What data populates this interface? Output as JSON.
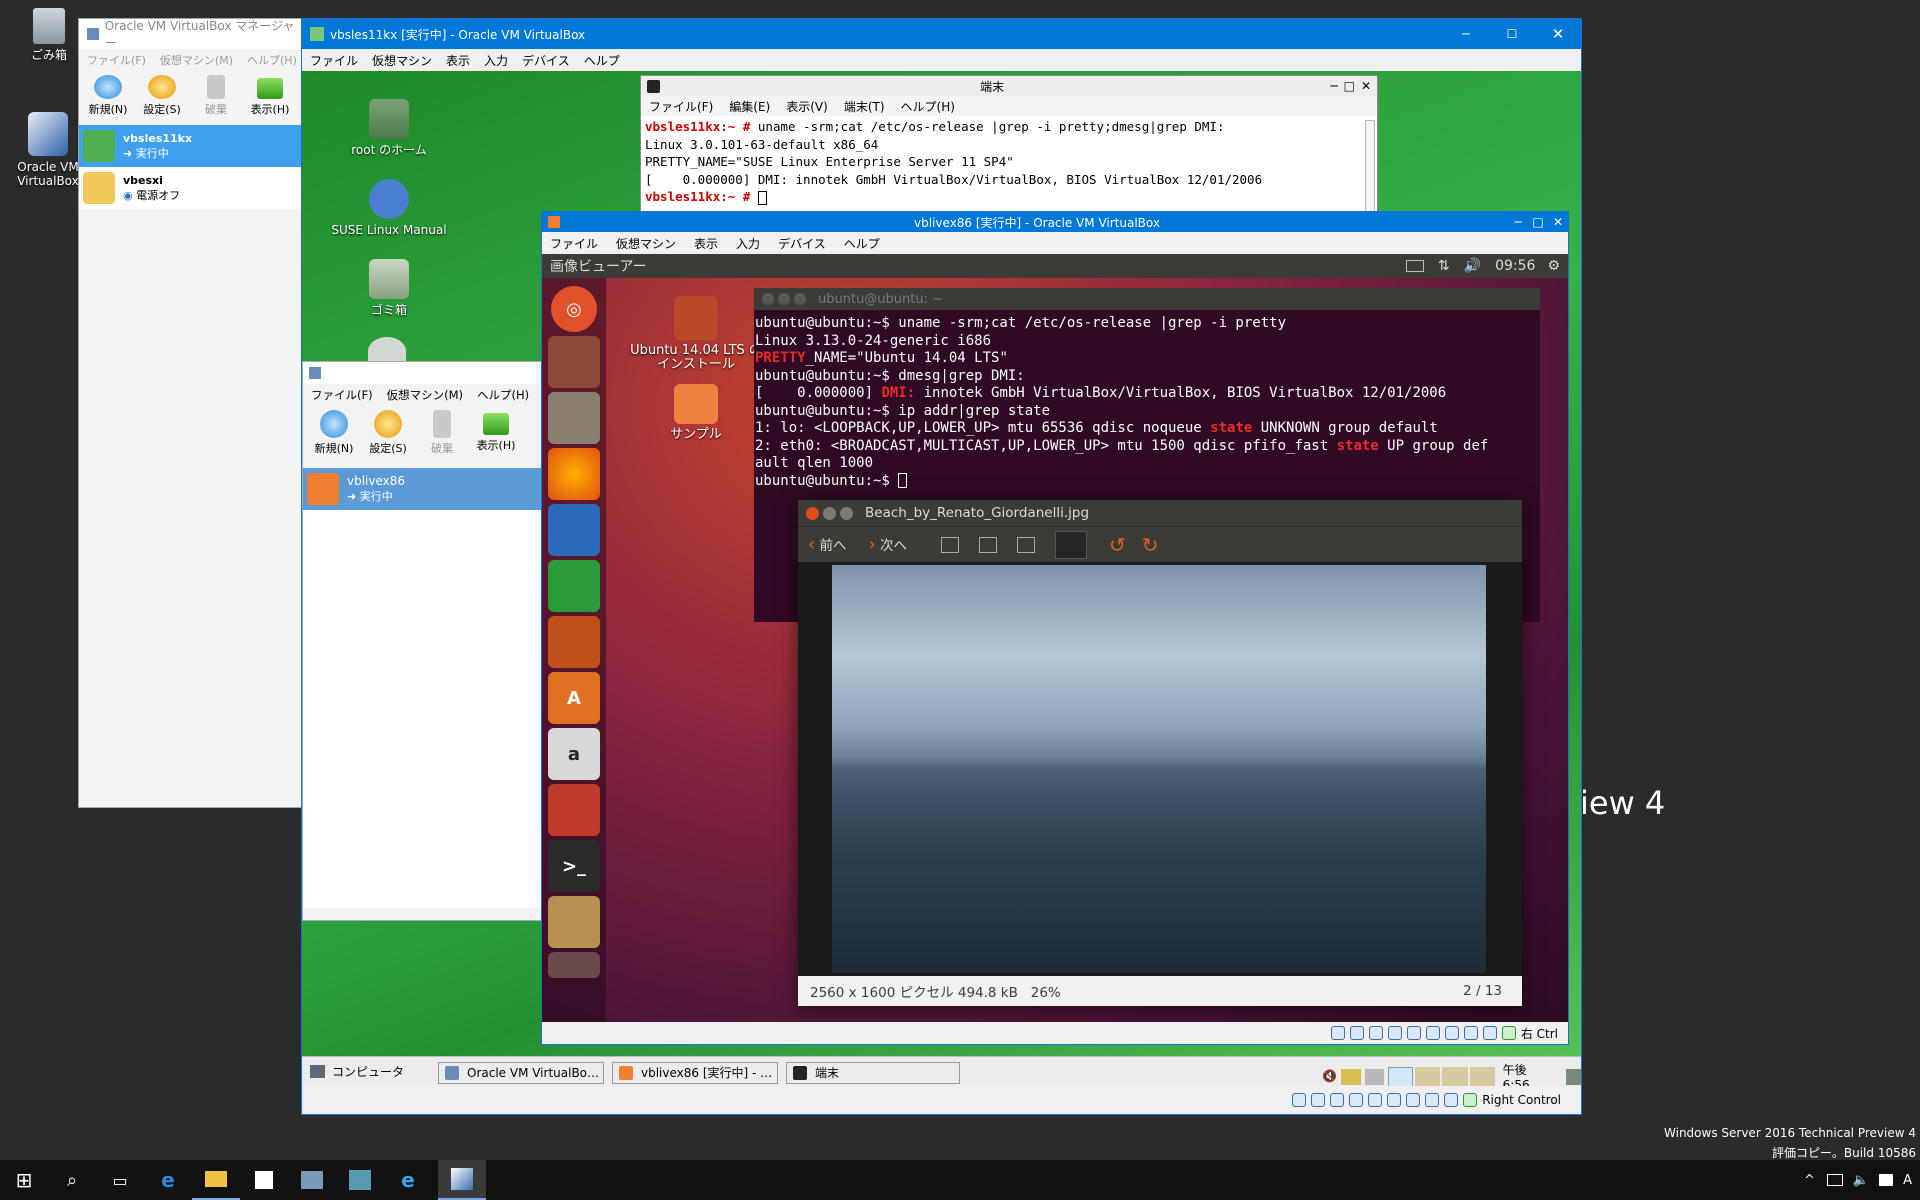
{
  "desktop": {
    "icons": [
      {
        "label": "ごみ箱"
      },
      {
        "label": "Oracle VM VirtualBox"
      }
    ],
    "watermark_fragment": "iew 4",
    "winver_line1": "Windows Server 2016 Technical Preview 4",
    "winver_line2": "評価コピー。Build 10586"
  },
  "vbox_manager_host": {
    "title": "Oracle VM VirtualBox マネージャー",
    "menu": [
      "ファイル(F)",
      "仮想マシン(M)",
      "ヘルプ(H)"
    ],
    "toolbar": [
      "新規(N)",
      "設定(S)",
      "破棄",
      "表示(H)"
    ],
    "vms": [
      {
        "name": "vbsles11kx",
        "state": "実行中"
      },
      {
        "name": "vbesxi",
        "state": "電源オフ"
      }
    ]
  },
  "suse_vm_window": {
    "title": "vbsles11kx [実行中] - Oracle VM VirtualBox",
    "menu": [
      "ファイル",
      "仮想マシン",
      "表示",
      "入力",
      "デバイス",
      "ヘルプ"
    ],
    "desktop_icons": [
      "root のホーム",
      "SUSE Linux Manual",
      "ゴミ箱"
    ],
    "taskbar": {
      "start": "コンピュータ",
      "items": [
        "Oracle VM VirtualBo…",
        "vblivex86 [実行中] - …",
        "端末"
      ],
      "clock": "午後 6:56"
    },
    "status_right": "Right Control"
  },
  "suse_terminal": {
    "title": "端末",
    "menu": [
      "ファイル(F)",
      "編集(E)",
      "表示(V)",
      "端末(T)",
      "ヘルプ(H)"
    ],
    "lines": [
      {
        "prompt": "vbsles11kx:~ # ",
        "text": "uname -srm;cat /etc/os-release |grep -i pretty;dmesg|grep DMI:"
      },
      {
        "prompt": "",
        "text": "Linux 3.0.101-63-default x86_64"
      },
      {
        "prompt": "",
        "text": "PRETTY_NAME=\"SUSE Linux Enterprise Server 11 SP4\""
      },
      {
        "prompt": "",
        "text": "[    0.000000] DMI: innotek GmbH VirtualBox/VirtualBox, BIOS VirtualBox 12/01/2006"
      },
      {
        "prompt": "vbsles11kx:~ # ",
        "text": ""
      }
    ]
  },
  "suse_vbox_manager": {
    "menu": [
      "ファイル(F)",
      "仮想マシン(M)",
      "ヘルプ(H)"
    ],
    "toolbar": [
      "新規(N)",
      "設定(S)",
      "破棄",
      "表示(H)"
    ],
    "vm": {
      "name": "vblivex86",
      "state": "実行中"
    }
  },
  "ubuntu_vm_window": {
    "title": "vblivex86 [実行中] - Oracle VM VirtualBox",
    "menu": [
      "ファイル",
      "仮想マシン",
      "表示",
      "入力",
      "デバイス",
      "ヘルプ"
    ],
    "panel_app": "画像ビューアー",
    "panel_clock": "09:56",
    "desktop_icons": [
      "Ubuntu 14.04 LTS のインストール",
      "サンプル"
    ],
    "status_right": "右 Ctrl"
  },
  "ubuntu_terminal": {
    "title": "ubuntu@ubuntu: ~",
    "lines": [
      [
        {
          "t": "ubuntu@ubuntu:~$ uname -srm;cat /etc/os-release |grep -i pretty",
          "c": ""
        }
      ],
      [
        {
          "t": "Linux 3.13.0-24-generic i686",
          "c": ""
        }
      ],
      [
        {
          "t": "PRETTY",
          "c": "red"
        },
        {
          "t": "_NAME=\"Ubuntu 14.04 LTS\"",
          "c": ""
        }
      ],
      [
        {
          "t": "ubuntu@ubuntu:~$ dmesg|grep DMI:",
          "c": ""
        }
      ],
      [
        {
          "t": "[    0.000000] ",
          "c": ""
        },
        {
          "t": "DMI:",
          "c": "red"
        },
        {
          "t": " innotek GmbH VirtualBox/VirtualBox, BIOS VirtualBox 12/01/2006",
          "c": ""
        }
      ],
      [
        {
          "t": "ubuntu@ubuntu:~$ ip addr|grep state",
          "c": ""
        }
      ],
      [
        {
          "t": "1: lo: <LOOPBACK,UP,LOWER_UP> mtu 65536 qdisc noqueue ",
          "c": ""
        },
        {
          "t": "state",
          "c": "red"
        },
        {
          "t": " UNKNOWN group default",
          "c": ""
        }
      ],
      [
        {
          "t": "2: eth0: <BROADCAST,MULTICAST,UP,LOWER_UP> mtu 1500 qdisc pfifo_fast ",
          "c": ""
        },
        {
          "t": "state",
          "c": "red"
        },
        {
          "t": " UP group def",
          "c": ""
        }
      ],
      [
        {
          "t": "ault qlen 1000",
          "c": ""
        }
      ],
      [
        {
          "t": "ubuntu@ubuntu:~$ ",
          "c": ""
        }
      ]
    ]
  },
  "image_viewer": {
    "title": "Beach_by_Renato_Giordanelli.jpg",
    "prev": "前へ",
    "next": "次へ",
    "status_info": "2560 x 1600 ピクセル 494.8 kB   26%",
    "status_page": "2 / 13"
  },
  "colors": {
    "host_titlebar": "#0078d7",
    "suse_green": "#2fa83c",
    "ubuntu_bg": "#5a1a3a",
    "terminal_bg": "#300a24",
    "term_red": "#ef2929"
  }
}
